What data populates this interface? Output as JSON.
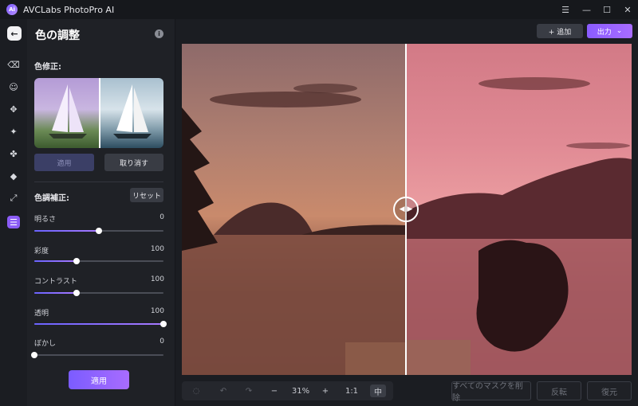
{
  "app": {
    "title": "AVCLabs PhotoPro AI",
    "logo_text": "Ai"
  },
  "window_controls": {
    "menu": "☰",
    "minimize": "—",
    "maximize": "☐",
    "close": "✕"
  },
  "rail": {
    "items": [
      {
        "icon": "eraser-icon",
        "glyph": "⌫"
      },
      {
        "icon": "face-retouch-icon",
        "glyph": "☺"
      },
      {
        "icon": "enhance-icon",
        "glyph": "✥"
      },
      {
        "icon": "colorize-icon",
        "glyph": "✦"
      },
      {
        "icon": "cutout-icon",
        "glyph": "✤"
      },
      {
        "icon": "fill-icon",
        "glyph": "◆"
      },
      {
        "icon": "resize-icon",
        "glyph": "⤢"
      },
      {
        "icon": "color-adjust-icon",
        "glyph": "☰"
      }
    ]
  },
  "panel": {
    "title": "色の調整",
    "back_glyph": "←",
    "info_glyph": "i",
    "color_correction": {
      "label": "色修正:",
      "apply_label": "適用",
      "cancel_label": "取り消す"
    },
    "tone": {
      "label": "色調補正:",
      "reset_label": "リセット",
      "sliders": [
        {
          "label": "明るさ",
          "value": "0",
          "fraction": 0.5
        },
        {
          "label": "彩度",
          "value": "100",
          "fraction": 0.33
        },
        {
          "label": "コントラスト",
          "value": "100",
          "fraction": 0.33
        },
        {
          "label": "透明",
          "value": "100",
          "fraction": 1.0
        },
        {
          "label": "ぼかし",
          "value": "0",
          "fraction": 0.0
        }
      ]
    },
    "apply_label": "適用"
  },
  "topbar": {
    "add_label": "+ 追加",
    "export_label": "出力",
    "export_chevron": "⌄"
  },
  "split": {
    "handle_glyph": "◀ ▶"
  },
  "zoombar": {
    "select_glyph": "◌",
    "undo_glyph": "↶",
    "redo_glyph": "↷",
    "zoom_out_glyph": "−",
    "zoom_value": "31%",
    "zoom_in_glyph": "+",
    "actual_size_label": "1:1",
    "compare_label": "中"
  },
  "actions": {
    "remove_masks_label": "すべてのマスクを削除",
    "invert_label": "反転",
    "restore_label": "復元"
  }
}
